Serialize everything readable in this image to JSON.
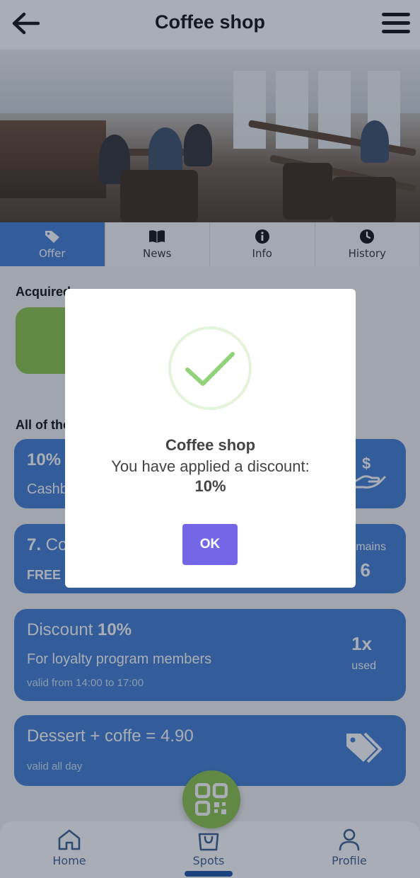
{
  "header": {
    "title": "Coffee shop"
  },
  "tabs": [
    {
      "label": "Offer",
      "active": true,
      "icon": "tag-icon"
    },
    {
      "label": "News",
      "active": false,
      "icon": "book-icon"
    },
    {
      "label": "Info",
      "active": false,
      "icon": "info-icon"
    },
    {
      "label": "History",
      "active": false,
      "icon": "clock-icon"
    }
  ],
  "sections": {
    "acquired_title": "Acquired",
    "all_title": "All of the offers"
  },
  "offers": [
    {
      "title_bold": "10%",
      "subtitle": "Cashback",
      "icon": "money-hand-icon"
    },
    {
      "title_bold": "7.",
      "title_rest": " Coffee",
      "subtitle": "FREE",
      "remains_label": "remains",
      "remains_value": "6"
    },
    {
      "title_plain": "Discount ",
      "title_bold": "10%",
      "subtitle": "For loyalty program members",
      "validity": "valid from 14:00 to 17:00",
      "count": "1x",
      "count_label": "used"
    },
    {
      "title_plain": "Dessert + coffe = 4.90",
      "validity": "valid all day",
      "icon": "tags-icon"
    }
  ],
  "nav": [
    {
      "label": "Home",
      "icon": "home-icon"
    },
    {
      "label": "Spots",
      "icon": "bag-icon",
      "active": true
    },
    {
      "label": "Profile",
      "icon": "user-icon"
    }
  ],
  "modal": {
    "title": "Coffee shop",
    "message": "You have applied a discount:",
    "value": "10%",
    "ok_label": "OK"
  },
  "colors": {
    "primary": "#3f7ed4",
    "accent_green": "#8bc34a",
    "ok_button": "#7367e8"
  }
}
